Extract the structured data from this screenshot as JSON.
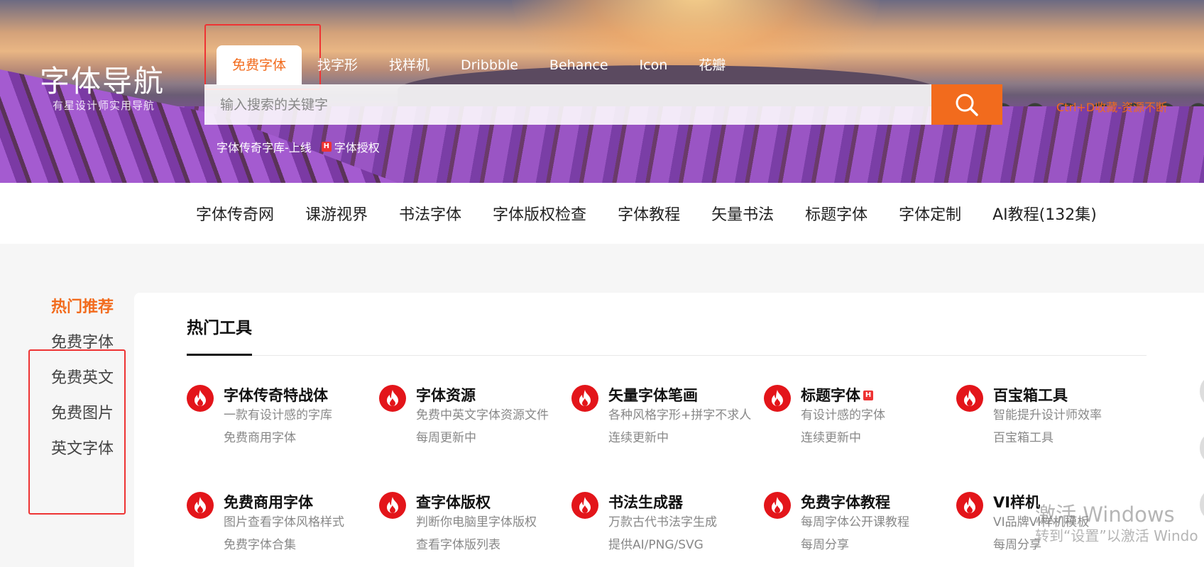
{
  "brand": {
    "title": "字体导航",
    "subtitle": "有星设计师实用导航"
  },
  "search": {
    "tabs": [
      {
        "label": "免费字体",
        "active": true
      },
      {
        "label": "找字形",
        "active": false
      },
      {
        "label": "找样机",
        "active": false
      },
      {
        "label": "Dribbble",
        "active": false
      },
      {
        "label": "Behance",
        "active": false
      },
      {
        "label": "Icon",
        "active": false
      },
      {
        "label": "花瓣",
        "active": false
      }
    ],
    "placeholder": "输入搜索的关键字",
    "value": "",
    "button_icon": "search-icon",
    "hint": "Ctrl+D收藏-资源不断",
    "hot_links": [
      {
        "label": "字体传奇字库-上线",
        "badge": ""
      },
      {
        "label": "字体授权",
        "badge": "H"
      }
    ]
  },
  "nav": {
    "items": [
      "字体传奇网",
      "课游视界",
      "书法字体",
      "字体版权检查",
      "字体教程",
      "矢量书法",
      "标题字体",
      "字体定制",
      "AI教程(132集)"
    ]
  },
  "sidebar": {
    "items": [
      {
        "label": "热门推荐",
        "active": true
      },
      {
        "label": "免费字体",
        "active": false
      },
      {
        "label": "免费英文",
        "active": false
      },
      {
        "label": "免费图片",
        "active": false
      },
      {
        "label": "英文字体",
        "active": false
      }
    ]
  },
  "main": {
    "section_title": "热门工具",
    "tools": [
      {
        "name": "字体传奇特战体",
        "desc": "一款有设计感的字库",
        "tag": "免费商用字体",
        "badge": ""
      },
      {
        "name": "字体资源",
        "desc": "免费中英文字体资源文件",
        "tag": "每周更新中",
        "badge": ""
      },
      {
        "name": "矢量字体笔画",
        "desc": "各种风格字形+拼字不求人",
        "tag": "连续更新中",
        "badge": ""
      },
      {
        "name": "标题字体",
        "desc": "有设计感的字体",
        "tag": "连续更新中",
        "badge": "H"
      },
      {
        "name": "百宝箱工具",
        "desc": "智能提升设计师效率",
        "tag": "百宝箱工具",
        "badge": ""
      },
      {
        "name": "免费商用字体",
        "desc": "图片查看字体风格样式",
        "tag": "免费字体合集",
        "badge": ""
      },
      {
        "name": "查字体版权",
        "desc": "判断你电脑里字体版权",
        "tag": "查看字体版列表",
        "badge": ""
      },
      {
        "name": "书法生成器",
        "desc": "万款古代书法字生成",
        "tag": "提供AI/PNG/SVG",
        "badge": ""
      },
      {
        "name": "免费字体教程",
        "desc": "每周字体公开课教程",
        "tag": "每周分享",
        "badge": ""
      },
      {
        "name": "VI样机",
        "desc": "VI品牌VI样机模板",
        "tag": "每周分享",
        "badge": ""
      }
    ],
    "tool_icon": "flame-icon"
  },
  "watermark": {
    "line1": "激活 Windows",
    "line2": "转到“设置”以激活 Windo"
  },
  "colors": {
    "accent": "#f26b1d",
    "highlight_box": "#e33333",
    "icon_red": "#e3151a"
  }
}
